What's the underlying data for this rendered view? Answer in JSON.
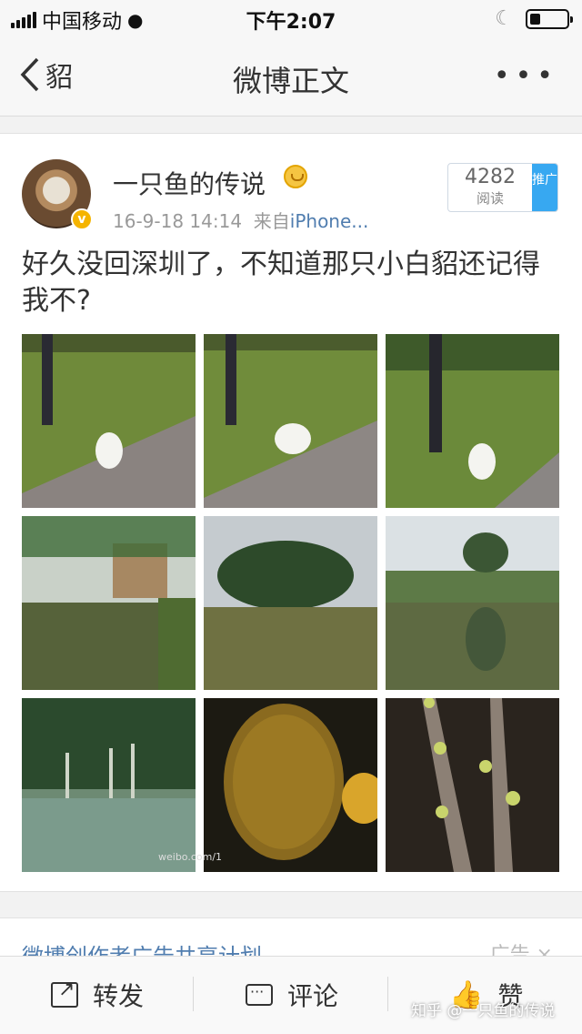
{
  "status_bar": {
    "carrier": "中国移动",
    "time": "下午2:07",
    "battery_level": 0.3
  },
  "nav": {
    "back_label": "貂",
    "title": "微博正文",
    "more_icon": "more-icon"
  },
  "post": {
    "username": "一只鱼的传说",
    "timestamp": "16-9-18 14:14",
    "source_prefix": "来自",
    "source": "iPhone...",
    "reads_count": "4282",
    "reads_label": "阅读",
    "promote_label": "推广",
    "text": "好久没回深圳了，不知道那只小白貂还记得我不?",
    "image_watermark": "weibo.com/1"
  },
  "ad": {
    "title": "微博创作者广告共享计划",
    "label": "广告 ×"
  },
  "toolbar": {
    "repost_label": "转发",
    "comment_label": "评论",
    "like_label": "赞"
  },
  "footer_watermark": "知乎 @一只鱼的传说",
  "colors": {
    "link_blue": "#507daf",
    "promote_blue": "#37a8f1",
    "badge_gold": "#f5b400"
  }
}
